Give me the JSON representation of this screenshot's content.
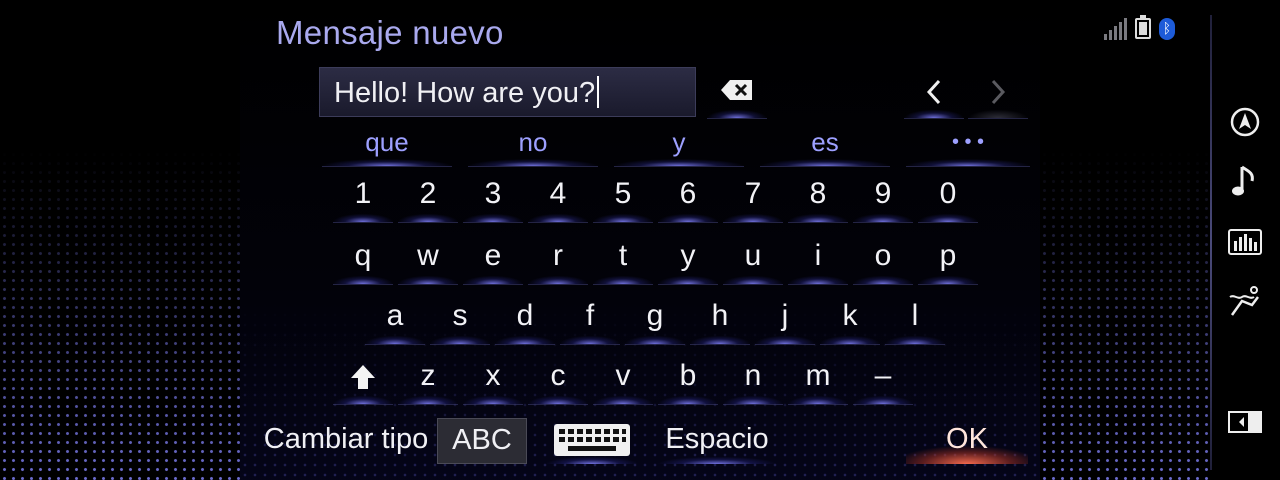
{
  "header": {
    "title": "Mensaje nuevo"
  },
  "input": {
    "value": "Hello! How are you?"
  },
  "suggestions": [
    "que",
    "no",
    "y",
    "es",
    "• • •"
  ],
  "rows": {
    "numbers": [
      "1",
      "2",
      "3",
      "4",
      "5",
      "6",
      "7",
      "8",
      "9",
      "0"
    ],
    "row1": [
      "q",
      "w",
      "e",
      "r",
      "t",
      "y",
      "u",
      "i",
      "o",
      "p"
    ],
    "row2": [
      "a",
      "s",
      "d",
      "f",
      "g",
      "h",
      "j",
      "k",
      "l"
    ],
    "row3": [
      "z",
      "x",
      "c",
      "v",
      "b",
      "n",
      "m",
      "–"
    ]
  },
  "bottom": {
    "change_type": "Cambiar tipo",
    "abc": "ABC",
    "space": "Espacio",
    "ok": "OK"
  },
  "icons": {
    "status": [
      "signal-icon",
      "battery-icon",
      "bluetooth-icon"
    ],
    "sidebar": [
      "navigation-icon",
      "music-note-icon",
      "equalizer-icon",
      "seat-climate-icon",
      "screen-split-icon"
    ]
  },
  "colors": {
    "accent": "#9da0ff",
    "title": "#a9a9ee",
    "ok_glow": "#ff6e50",
    "bluetooth": "#1d5bd8"
  }
}
